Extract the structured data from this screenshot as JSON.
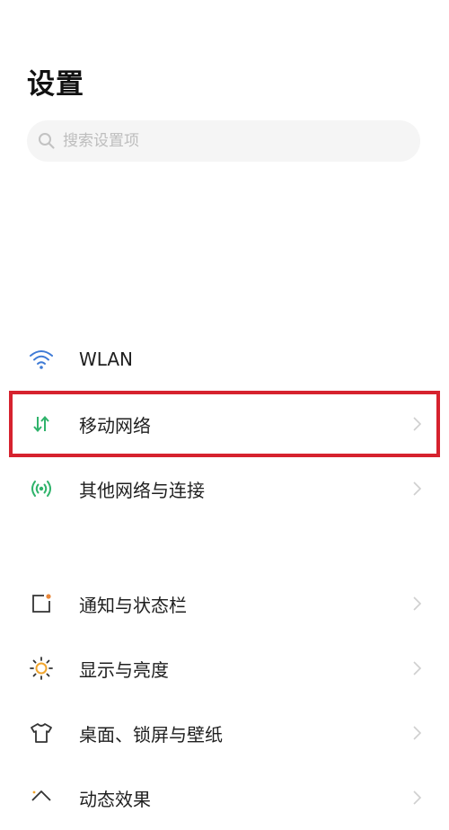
{
  "header": {
    "title": "设置"
  },
  "search": {
    "placeholder": "搜索设置项"
  },
  "settings": {
    "wlan": {
      "label": "WLAN",
      "icon": "wifi-icon"
    },
    "mobile_network": {
      "label": "移动网络",
      "icon": "data-arrows-icon"
    },
    "other_networks": {
      "label": "其他网络与连接",
      "icon": "signal-broadcast-icon"
    },
    "notifications": {
      "label": "通知与状态栏",
      "icon": "notification-square-icon"
    },
    "display": {
      "label": "显示与亮度",
      "icon": "sun-icon"
    },
    "desktop": {
      "label": "桌面、锁屏与壁纸",
      "icon": "tshirt-icon"
    },
    "dynamic_effects": {
      "label": "动态效果",
      "icon": "effects-icon"
    }
  },
  "colors": {
    "highlight": "#d6222e",
    "wifi": "#3f7bd6",
    "green": "#2fb36b",
    "orange": "#e8873a",
    "sun": "#f1a52c"
  }
}
